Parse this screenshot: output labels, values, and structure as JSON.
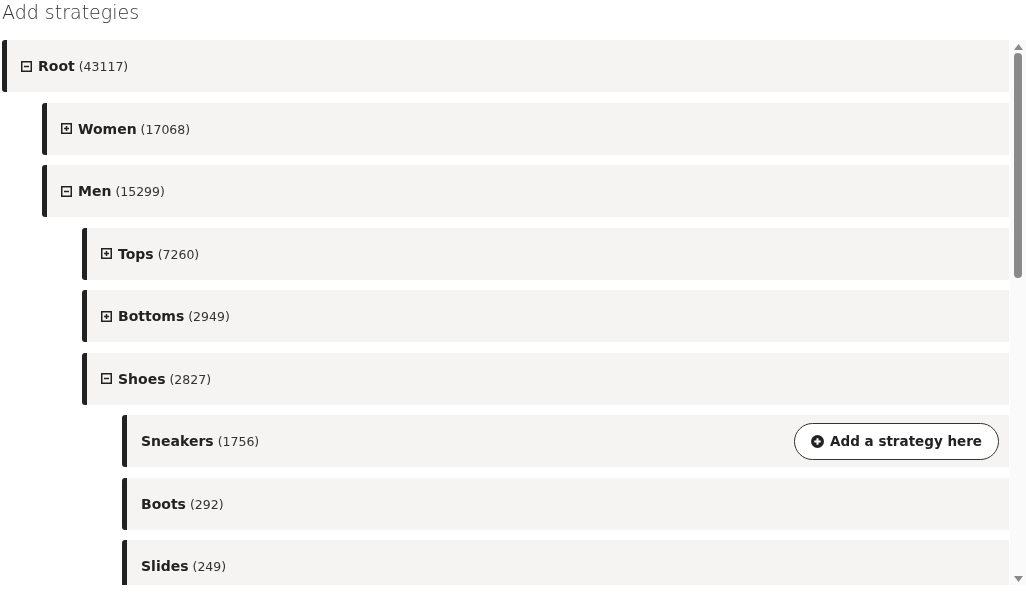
{
  "title": "Add strategies",
  "tree": [
    {
      "kind": "branch",
      "name": "Root",
      "count": "(43117)",
      "expanded": true,
      "children": [
        {
          "kind": "branch",
          "name": "Women",
          "count": "(17068)",
          "expanded": false
        },
        {
          "kind": "branch",
          "name": "Men",
          "count": "(15299)",
          "expanded": true,
          "children": [
            {
              "kind": "branch",
              "name": "Tops",
              "count": "(7260)",
              "expanded": false
            },
            {
              "kind": "branch",
              "name": "Bottoms",
              "count": "(2949)",
              "expanded": false
            },
            {
              "kind": "branch",
              "name": "Shoes",
              "count": "(2827)",
              "expanded": true,
              "children": [
                {
                  "kind": "leaf",
                  "name": "Sneakers",
                  "count": "(1756)",
                  "action": "Add a strategy here"
                },
                {
                  "kind": "leaf",
                  "name": "Boots",
                  "count": "(292)"
                },
                {
                  "kind": "leaf",
                  "name": "Slides",
                  "count": "(249)"
                }
              ]
            }
          ]
        }
      ]
    }
  ]
}
